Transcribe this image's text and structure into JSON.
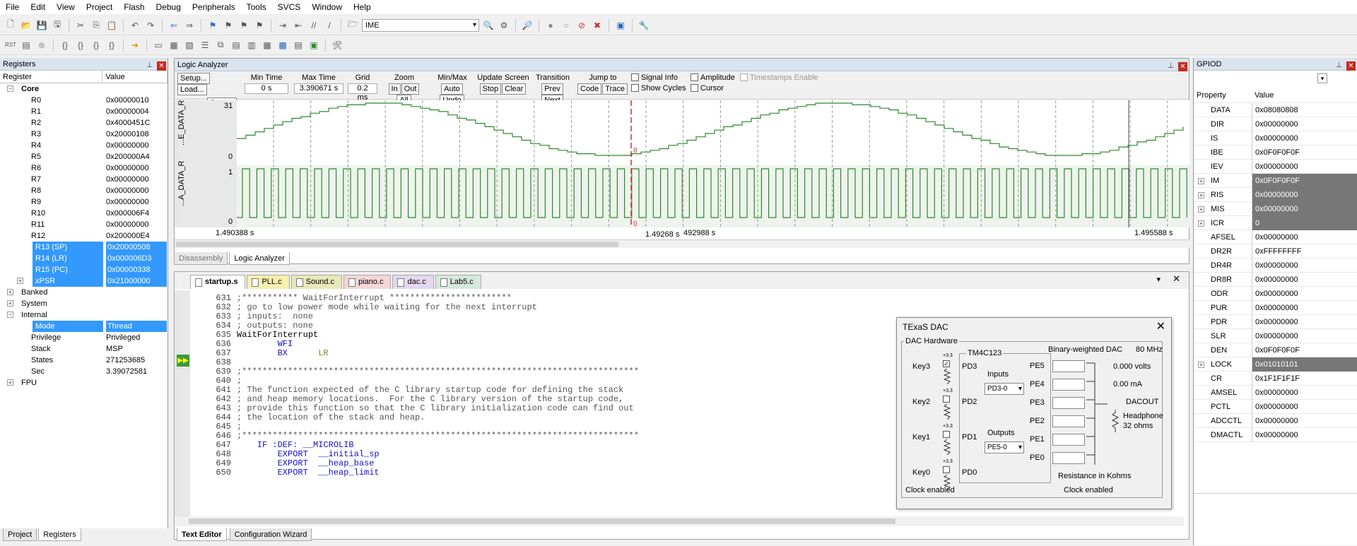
{
  "menu": [
    "File",
    "Edit",
    "View",
    "Project",
    "Flash",
    "Debug",
    "Peripherals",
    "Tools",
    "SVCS",
    "Window",
    "Help"
  ],
  "toolbar": {
    "ime_value": "IME"
  },
  "registers_panel": {
    "title": "Registers",
    "col_register": "Register",
    "col_value": "Value",
    "core_label": "Core",
    "core": [
      {
        "name": "R0",
        "value": "0x00000010"
      },
      {
        "name": "R1",
        "value": "0x00000004"
      },
      {
        "name": "R2",
        "value": "0x4000451C"
      },
      {
        "name": "R3",
        "value": "0x20000108"
      },
      {
        "name": "R4",
        "value": "0x00000000"
      },
      {
        "name": "R5",
        "value": "0x200000A4"
      },
      {
        "name": "R6",
        "value": "0x00000000"
      },
      {
        "name": "R7",
        "value": "0x00000000"
      },
      {
        "name": "R8",
        "value": "0x00000000"
      },
      {
        "name": "R9",
        "value": "0x00000000"
      },
      {
        "name": "R10",
        "value": "0x000006F4"
      },
      {
        "name": "R11",
        "value": "0x00000000"
      },
      {
        "name": "R12",
        "value": "0x200000E4"
      },
      {
        "name": "R13 (SP)",
        "value": "0x20000508"
      },
      {
        "name": "R14 (LR)",
        "value": "0x000006D3"
      },
      {
        "name": "R15 (PC)",
        "value": "0x00000338"
      },
      {
        "name": "xPSR",
        "value": "0x21000000"
      }
    ],
    "banked": "Banked",
    "system": "System",
    "internal": "Internal",
    "internal_items": [
      {
        "name": "Mode",
        "value": "Thread"
      },
      {
        "name": "Privilege",
        "value": "Privileged"
      },
      {
        "name": "Stack",
        "value": "MSP"
      },
      {
        "name": "States",
        "value": "271253685"
      },
      {
        "name": "Sec",
        "value": "3.39072581"
      }
    ],
    "fpu": "FPU",
    "tabs": [
      "Project",
      "Registers"
    ]
  },
  "logic_analyzer": {
    "title": "Logic Analyzer",
    "setup": "Setup...",
    "load": "Load...",
    "save": "Save...",
    "min_time_label": "Min Time",
    "min_time": "0 s",
    "max_time_label": "Max Time",
    "max_time": "3.390671 s",
    "grid_label": "Grid",
    "grid": "0.2 ms",
    "zoom_label": "Zoom",
    "zoom_in": "In",
    "zoom_out": "Out",
    "zoom_all": "All",
    "minmax_label": "Min/Max",
    "auto": "Auto",
    "undo": "Undo",
    "update_label": "Update Screen",
    "stop": "Stop",
    "clear": "Clear",
    "transition_label": "Transition",
    "prev": "Prev",
    "next": "Next",
    "jump_label": "Jump to",
    "code": "Code",
    "trace": "Trace",
    "signal_info": "Signal Info",
    "show_cycles": "Show Cycles",
    "amplitude": "Amplitude",
    "cursor": "Cursor",
    "timestamps": "Timestamps Enable",
    "signal1": "...E_DATA_R",
    "signal2": "...A_DATA_R",
    "s1_max": "31",
    "s1_min": "0",
    "s2_max": "1",
    "s2_min": "0",
    "t_start": "1.490388 s",
    "t_cursor": "1.49268 s",
    "t_mid": "492988 s",
    "t_end": "1.495588 s",
    "cursor_val1": "8",
    "cursor_val2": "0",
    "tabs": [
      "Disassembly",
      "Logic Analyzer"
    ]
  },
  "chart_data": {
    "type": "line",
    "series": [
      {
        "name": "...E_DATA_R",
        "x": [
          "1.490388 s",
          "1.495588 s"
        ],
        "ylim": [
          0,
          31
        ],
        "cursor_value": 8
      },
      {
        "name": "...A_DATA_R",
        "x": [
          "1.490388 s",
          "1.495588 s"
        ],
        "ylim": [
          0,
          1
        ],
        "cursor_value": 0
      }
    ]
  },
  "editor": {
    "tabs": [
      {
        "label": "startup.s",
        "color": "#ffffff"
      },
      {
        "label": "PLL.c",
        "color": "#f5efb0"
      },
      {
        "label": "Sound.c",
        "color": "#e8e8b8"
      },
      {
        "label": "piano.c",
        "color": "#f4d6d6"
      },
      {
        "label": "dac.c",
        "color": "#e4d8f0"
      },
      {
        "label": "Lab5.c",
        "color": "#d6e8dc"
      }
    ],
    "lines": [
      {
        "n": "631",
        "t": ";*********** WaitForInterrupt ************************",
        "c": "cmt"
      },
      {
        "n": "632",
        "t": "; go to low power mode while waiting for the next interrupt",
        "c": "cmt"
      },
      {
        "n": "633",
        "t": "; inputs:  none",
        "c": "cmt"
      },
      {
        "n": "634",
        "t": "; outputs: none",
        "c": "cmt"
      },
      {
        "n": "635",
        "t": "WaitForInterrupt",
        "c": ""
      },
      {
        "n": "636",
        "t": "        WFI",
        "c": "kw"
      },
      {
        "n": "637",
        "t": "        BX      ",
        "c": "kw",
        "extra": "LR"
      },
      {
        "n": "638",
        "t": "",
        "c": ""
      },
      {
        "n": "639",
        "t": ";******************************************************************************",
        "c": "cmt"
      },
      {
        "n": "640",
        "t": ";",
        "c": "cmt"
      },
      {
        "n": "641",
        "t": "; The function expected of the C library startup code for defining the stack",
        "c": "cmt"
      },
      {
        "n": "642",
        "t": "; and heap memory locations.  For the C library version of the startup code,",
        "c": "cmt"
      },
      {
        "n": "643",
        "t": "; provide this function so that the C library initialization code can find out",
        "c": "cmt"
      },
      {
        "n": "644",
        "t": "; the location of the stack and heap.",
        "c": "cmt"
      },
      {
        "n": "645",
        "t": ";",
        "c": "cmt"
      },
      {
        "n": "646",
        "t": ";******************************************************************************",
        "c": "cmt"
      },
      {
        "n": "647",
        "t": "    IF :DEF: __MICROLIB",
        "c": "kw"
      },
      {
        "n": "648",
        "t": "        EXPORT  __initial_sp",
        "c": "kw"
      },
      {
        "n": "649",
        "t": "        EXPORT  __heap_base",
        "c": "kw"
      },
      {
        "n": "650",
        "t": "        EXPORT  __heap_limit",
        "c": "kw"
      }
    ],
    "bottom_tabs": [
      "Text Editor",
      "Configuration Wizard"
    ]
  },
  "dac": {
    "title": "TExaS DAC",
    "hardware": "DAC Hardware",
    "mcu": "TM4C123",
    "bw_dac": "Binary-weighted DAC",
    "freq": "80 MHz",
    "keys": [
      "Key3",
      "Key2",
      "Key1",
      "Key0"
    ],
    "pd": [
      "PD3",
      "PD2",
      "PD1",
      "PD0"
    ],
    "v33": "+3.3",
    "inputs_label": "Inputs",
    "inputs_value": "PD3-0",
    "outputs_label": "Outputs",
    "outputs_value": "PE5-0",
    "pe": [
      "PE5",
      "PE4",
      "PE3",
      "PE2",
      "PE1",
      "PE0"
    ],
    "volts": "0.000 volts",
    "ma": "0.00 mA",
    "dacout": "DACOUT",
    "headphone": "Headphone",
    "ohms": "32 ohms",
    "resistance": "Resistance in Kohms",
    "clock1": "Clock enabled",
    "clock2": "Clock enabled"
  },
  "gpio": {
    "title": "GPIOD",
    "col_property": "Property",
    "col_value": "Value",
    "rows": [
      {
        "name": "DATA",
        "value": "0x08080808",
        "exp": false,
        "hl": false
      },
      {
        "name": "DIR",
        "value": "0x00000000",
        "exp": false,
        "hl": false
      },
      {
        "name": "IS",
        "value": "0x00000000",
        "exp": false,
        "hl": false
      },
      {
        "name": "IBE",
        "value": "0x0F0F0F0F",
        "exp": false,
        "hl": false
      },
      {
        "name": "IEV",
        "value": "0x00000000",
        "exp": false,
        "hl": false
      },
      {
        "name": "IM",
        "value": "0x0F0F0F0F",
        "exp": true,
        "hl": true
      },
      {
        "name": "RIS",
        "value": "0x00000000",
        "exp": true,
        "hl": true
      },
      {
        "name": "MIS",
        "value": "0x00000000",
        "exp": true,
        "hl": true
      },
      {
        "name": "ICR",
        "value": "0",
        "exp": true,
        "hl": true
      },
      {
        "name": "AFSEL",
        "value": "0x00000000",
        "exp": false,
        "hl": false
      },
      {
        "name": "DR2R",
        "value": "0xFFFFFFFF",
        "exp": false,
        "hl": false
      },
      {
        "name": "DR4R",
        "value": "0x00000000",
        "exp": false,
        "hl": false
      },
      {
        "name": "DR8R",
        "value": "0x00000000",
        "exp": false,
        "hl": false
      },
      {
        "name": "ODR",
        "value": "0x00000000",
        "exp": false,
        "hl": false
      },
      {
        "name": "PUR",
        "value": "0x00000000",
        "exp": false,
        "hl": false
      },
      {
        "name": "PDR",
        "value": "0x00000000",
        "exp": false,
        "hl": false
      },
      {
        "name": "SLR",
        "value": "0x00000000",
        "exp": false,
        "hl": false
      },
      {
        "name": "DEN",
        "value": "0x0F0F0F0F",
        "exp": false,
        "hl": false
      },
      {
        "name": "LOCK",
        "value": "0x01010101",
        "exp": true,
        "hl": true
      },
      {
        "name": "CR",
        "value": "0x1F1F1F1F",
        "exp": false,
        "hl": false
      },
      {
        "name": "AMSEL",
        "value": "0x00000000",
        "exp": false,
        "hl": false
      },
      {
        "name": "PCTL",
        "value": "0x00000000",
        "exp": false,
        "hl": false
      },
      {
        "name": "ADCCTL",
        "value": "0x00000000",
        "exp": false,
        "hl": false
      },
      {
        "name": "DMACTL",
        "value": "0x00000000",
        "exp": false,
        "hl": false
      }
    ]
  }
}
